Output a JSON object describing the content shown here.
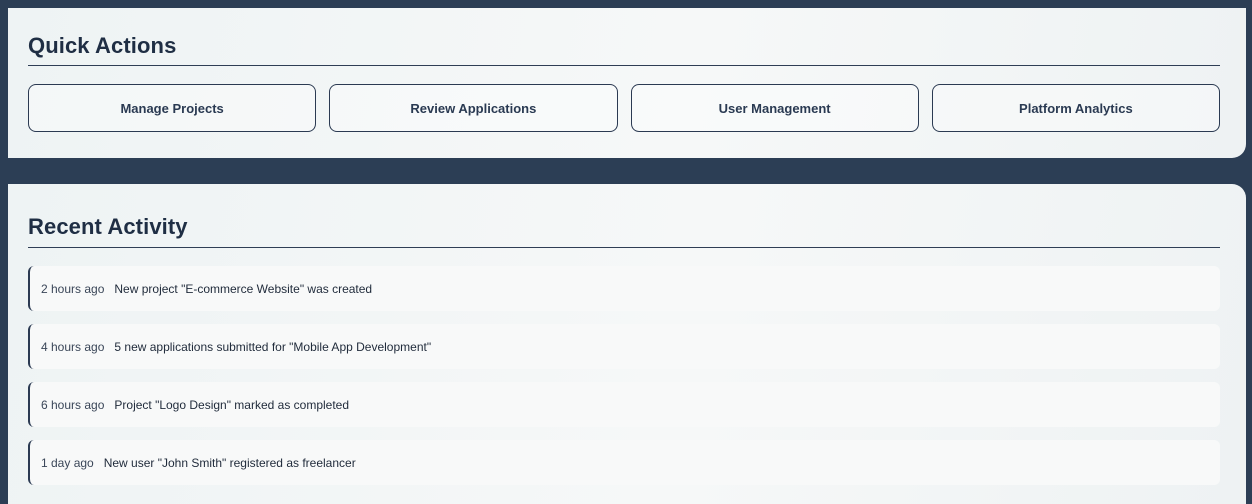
{
  "quick_actions": {
    "title": "Quick Actions",
    "buttons": [
      {
        "label": "Manage Projects"
      },
      {
        "label": "Review Applications"
      },
      {
        "label": "User Management"
      },
      {
        "label": "Platform Analytics"
      }
    ]
  },
  "recent_activity": {
    "title": "Recent Activity",
    "items": [
      {
        "time": "2 hours ago",
        "text": "New project \"E-commerce Website\" was created"
      },
      {
        "time": "4 hours ago",
        "text": "5 new applications submitted for \"Mobile App Development\""
      },
      {
        "time": "6 hours ago",
        "text": "Project \"Logo Design\" marked as completed"
      },
      {
        "time": "1 day ago",
        "text": "New user \"John Smith\" registered as freelancer"
      }
    ]
  },
  "colors": {
    "background": "#2c3e55",
    "panel": "#f3f6f6",
    "accent": "#2b3a52"
  }
}
